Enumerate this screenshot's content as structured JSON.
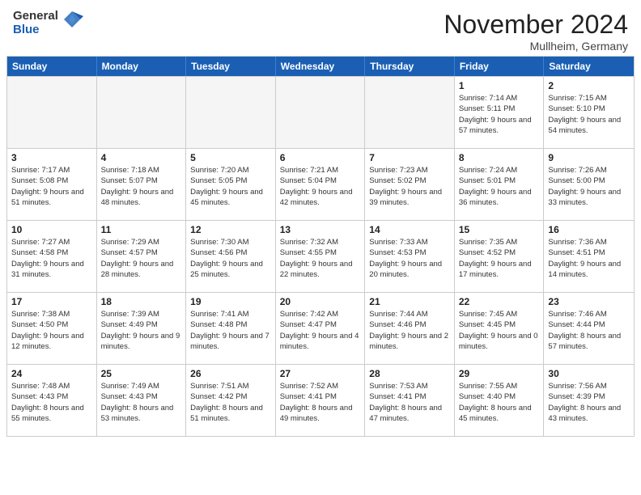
{
  "header": {
    "logo_general": "General",
    "logo_blue": "Blue",
    "month_title": "November 2024",
    "location": "Mullheim, Germany"
  },
  "calendar": {
    "days_of_week": [
      "Sunday",
      "Monday",
      "Tuesday",
      "Wednesday",
      "Thursday",
      "Friday",
      "Saturday"
    ],
    "rows": [
      [
        {
          "day": "",
          "info": "",
          "empty": true
        },
        {
          "day": "",
          "info": "",
          "empty": true
        },
        {
          "day": "",
          "info": "",
          "empty": true
        },
        {
          "day": "",
          "info": "",
          "empty": true
        },
        {
          "day": "",
          "info": "",
          "empty": true
        },
        {
          "day": "1",
          "info": "Sunrise: 7:14 AM\nSunset: 5:11 PM\nDaylight: 9 hours and 57 minutes."
        },
        {
          "day": "2",
          "info": "Sunrise: 7:15 AM\nSunset: 5:10 PM\nDaylight: 9 hours and 54 minutes."
        }
      ],
      [
        {
          "day": "3",
          "info": "Sunrise: 7:17 AM\nSunset: 5:08 PM\nDaylight: 9 hours and 51 minutes."
        },
        {
          "day": "4",
          "info": "Sunrise: 7:18 AM\nSunset: 5:07 PM\nDaylight: 9 hours and 48 minutes."
        },
        {
          "day": "5",
          "info": "Sunrise: 7:20 AM\nSunset: 5:05 PM\nDaylight: 9 hours and 45 minutes."
        },
        {
          "day": "6",
          "info": "Sunrise: 7:21 AM\nSunset: 5:04 PM\nDaylight: 9 hours and 42 minutes."
        },
        {
          "day": "7",
          "info": "Sunrise: 7:23 AM\nSunset: 5:02 PM\nDaylight: 9 hours and 39 minutes."
        },
        {
          "day": "8",
          "info": "Sunrise: 7:24 AM\nSunset: 5:01 PM\nDaylight: 9 hours and 36 minutes."
        },
        {
          "day": "9",
          "info": "Sunrise: 7:26 AM\nSunset: 5:00 PM\nDaylight: 9 hours and 33 minutes."
        }
      ],
      [
        {
          "day": "10",
          "info": "Sunrise: 7:27 AM\nSunset: 4:58 PM\nDaylight: 9 hours and 31 minutes."
        },
        {
          "day": "11",
          "info": "Sunrise: 7:29 AM\nSunset: 4:57 PM\nDaylight: 9 hours and 28 minutes."
        },
        {
          "day": "12",
          "info": "Sunrise: 7:30 AM\nSunset: 4:56 PM\nDaylight: 9 hours and 25 minutes."
        },
        {
          "day": "13",
          "info": "Sunrise: 7:32 AM\nSunset: 4:55 PM\nDaylight: 9 hours and 22 minutes."
        },
        {
          "day": "14",
          "info": "Sunrise: 7:33 AM\nSunset: 4:53 PM\nDaylight: 9 hours and 20 minutes."
        },
        {
          "day": "15",
          "info": "Sunrise: 7:35 AM\nSunset: 4:52 PM\nDaylight: 9 hours and 17 minutes."
        },
        {
          "day": "16",
          "info": "Sunrise: 7:36 AM\nSunset: 4:51 PM\nDaylight: 9 hours and 14 minutes."
        }
      ],
      [
        {
          "day": "17",
          "info": "Sunrise: 7:38 AM\nSunset: 4:50 PM\nDaylight: 9 hours and 12 minutes."
        },
        {
          "day": "18",
          "info": "Sunrise: 7:39 AM\nSunset: 4:49 PM\nDaylight: 9 hours and 9 minutes."
        },
        {
          "day": "19",
          "info": "Sunrise: 7:41 AM\nSunset: 4:48 PM\nDaylight: 9 hours and 7 minutes."
        },
        {
          "day": "20",
          "info": "Sunrise: 7:42 AM\nSunset: 4:47 PM\nDaylight: 9 hours and 4 minutes."
        },
        {
          "day": "21",
          "info": "Sunrise: 7:44 AM\nSunset: 4:46 PM\nDaylight: 9 hours and 2 minutes."
        },
        {
          "day": "22",
          "info": "Sunrise: 7:45 AM\nSunset: 4:45 PM\nDaylight: 9 hours and 0 minutes."
        },
        {
          "day": "23",
          "info": "Sunrise: 7:46 AM\nSunset: 4:44 PM\nDaylight: 8 hours and 57 minutes."
        }
      ],
      [
        {
          "day": "24",
          "info": "Sunrise: 7:48 AM\nSunset: 4:43 PM\nDaylight: 8 hours and 55 minutes."
        },
        {
          "day": "25",
          "info": "Sunrise: 7:49 AM\nSunset: 4:43 PM\nDaylight: 8 hours and 53 minutes."
        },
        {
          "day": "26",
          "info": "Sunrise: 7:51 AM\nSunset: 4:42 PM\nDaylight: 8 hours and 51 minutes."
        },
        {
          "day": "27",
          "info": "Sunrise: 7:52 AM\nSunset: 4:41 PM\nDaylight: 8 hours and 49 minutes."
        },
        {
          "day": "28",
          "info": "Sunrise: 7:53 AM\nSunset: 4:41 PM\nDaylight: 8 hours and 47 minutes."
        },
        {
          "day": "29",
          "info": "Sunrise: 7:55 AM\nSunset: 4:40 PM\nDaylight: 8 hours and 45 minutes."
        },
        {
          "day": "30",
          "info": "Sunrise: 7:56 AM\nSunset: 4:39 PM\nDaylight: 8 hours and 43 minutes."
        }
      ]
    ]
  }
}
